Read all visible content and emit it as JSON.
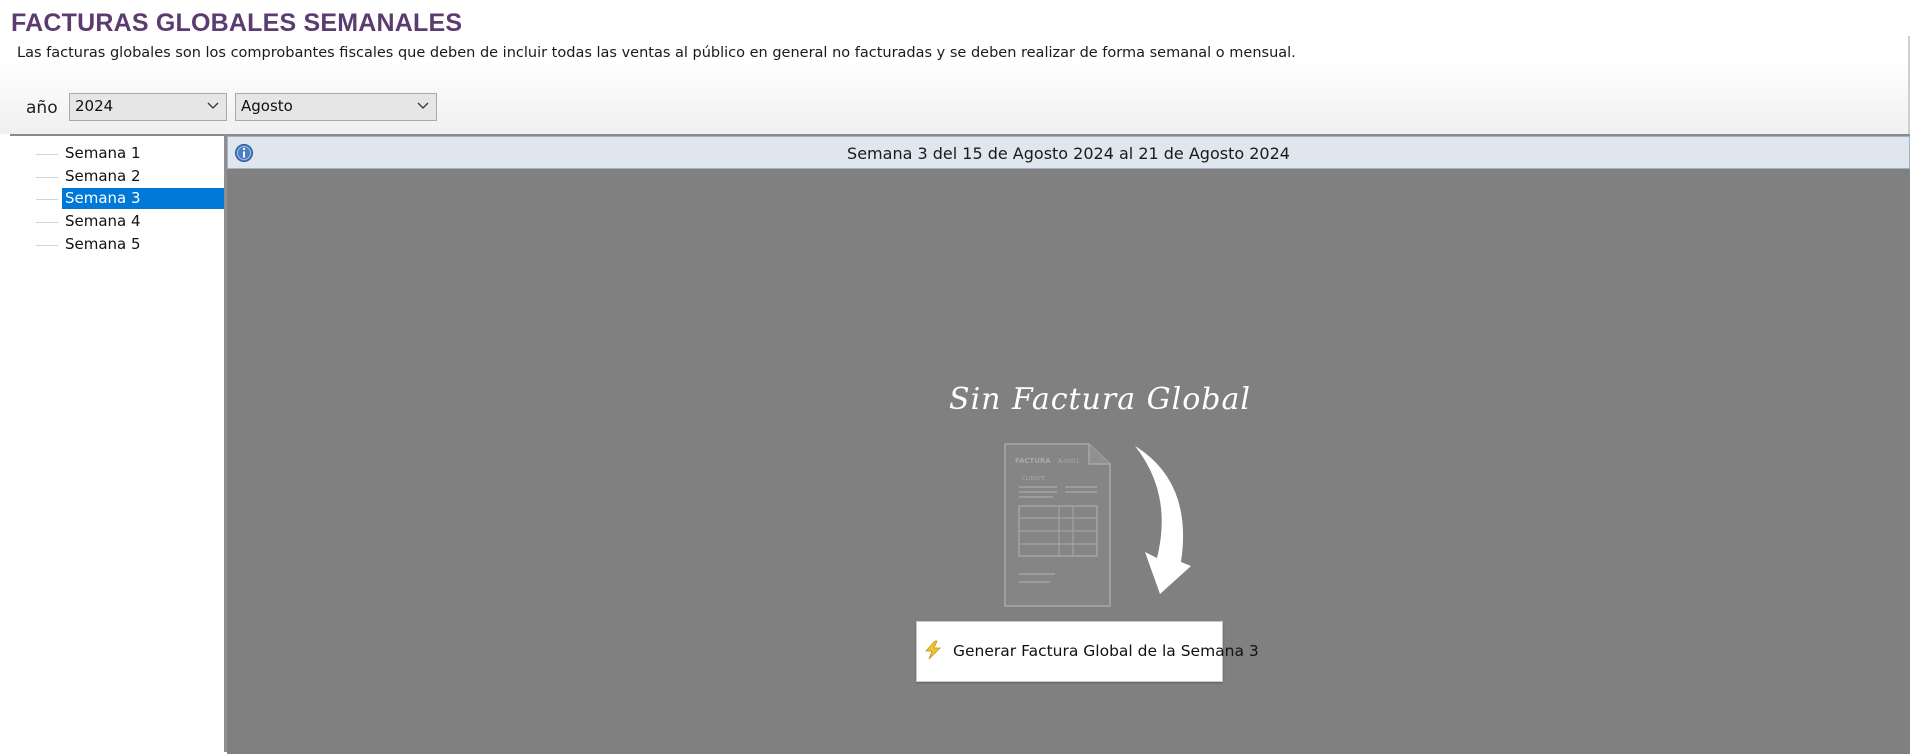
{
  "header": {
    "title": "FACTURAS GLOBALES SEMANALES",
    "subtitle": "Las facturas globales son los comprobantes fiscales que deben de incluir todas las ventas al público en general no facturadas y se deben realizar de forma semanal o mensual.",
    "title_color": "#5c3c70"
  },
  "filters": {
    "year_label": "año",
    "year_value": "2024",
    "month_value": "Agosto"
  },
  "weeks": [
    {
      "label": "Semana 1",
      "selected": false
    },
    {
      "label": "Semana 2",
      "selected": false
    },
    {
      "label": "Semana 3",
      "selected": true
    },
    {
      "label": "Semana 4",
      "selected": false
    },
    {
      "label": "Semana 5",
      "selected": false
    }
  ],
  "info_bar": {
    "icon": "info-icon",
    "text": "Semana 3 del 15 de Agosto 2024 al 21 de Agosto 2024"
  },
  "empty_state": {
    "title": "Sin Factura Global",
    "illustration": "invoice-document-icon",
    "doc_heading": "FACTURA",
    "doc_number": "A-0001",
    "doc_client": "CLIENTE",
    "button_icon": "lightning-icon",
    "button_label": "Generar Factura Global de la Semana 3"
  },
  "colors": {
    "selection": "#0078d7",
    "content_bg": "#808080",
    "info_bar_bg": "#dfe6ee"
  }
}
